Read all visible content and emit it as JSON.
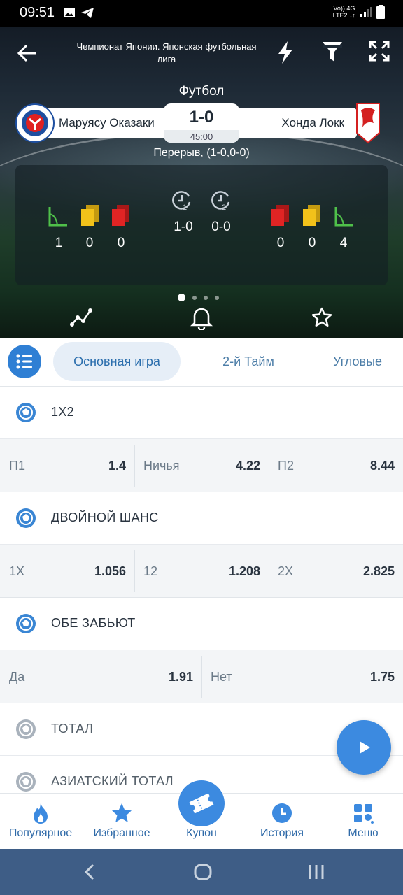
{
  "status_bar": {
    "time": "09:51",
    "net_top": "Vo)) 4G",
    "net_bottom": "LTE2 ↓↑"
  },
  "header": {
    "league": "Чемпионат Японии. Японская футбольная лига",
    "sport": "Футбол",
    "team_home": "Маруясу Оказаки",
    "team_away": "Хонда Локк",
    "score": "1-0",
    "match_time": "45:00",
    "period": "Перерыв, (1-0,0-0)"
  },
  "stats": {
    "home": {
      "corners": "1",
      "yellow": "0",
      "red": "0"
    },
    "away": {
      "red": "0",
      "yellow": "0",
      "corners": "4"
    },
    "half1_label": "1",
    "half2_label": "2",
    "half1_score": "1-0",
    "half2_score": "0-0"
  },
  "tabs": {
    "main": "Основная игра",
    "half2": "2-й Тайм",
    "corners": "Угловые"
  },
  "markets": [
    {
      "title": "1X2",
      "odds": [
        {
          "label": "П1",
          "value": "1.4"
        },
        {
          "label": "Ничья",
          "value": "4.22"
        },
        {
          "label": "П2",
          "value": "8.44"
        }
      ]
    },
    {
      "title": "ДВОЙНОЙ ШАНС",
      "odds": [
        {
          "label": "1X",
          "value": "1.056"
        },
        {
          "label": "12",
          "value": "1.208"
        },
        {
          "label": "2X",
          "value": "2.825"
        }
      ]
    },
    {
      "title": "ОБЕ ЗАБЬЮТ",
      "odds": [
        {
          "label": "Да",
          "value": "1.91"
        },
        {
          "label": "Нет",
          "value": "1.75"
        }
      ]
    },
    {
      "title": "ТОТАЛ"
    },
    {
      "title": "АЗИАТСКИЙ ТОТАЛ"
    }
  ],
  "bottom_nav": {
    "popular": "Популярное",
    "favorites": "Избранное",
    "coupon": "Купон",
    "history": "История",
    "menu": "Меню"
  },
  "colors": {
    "accent": "#3c8ae0",
    "nav_bar": "#3e5d86",
    "text_blue": "#2f6aa8"
  }
}
